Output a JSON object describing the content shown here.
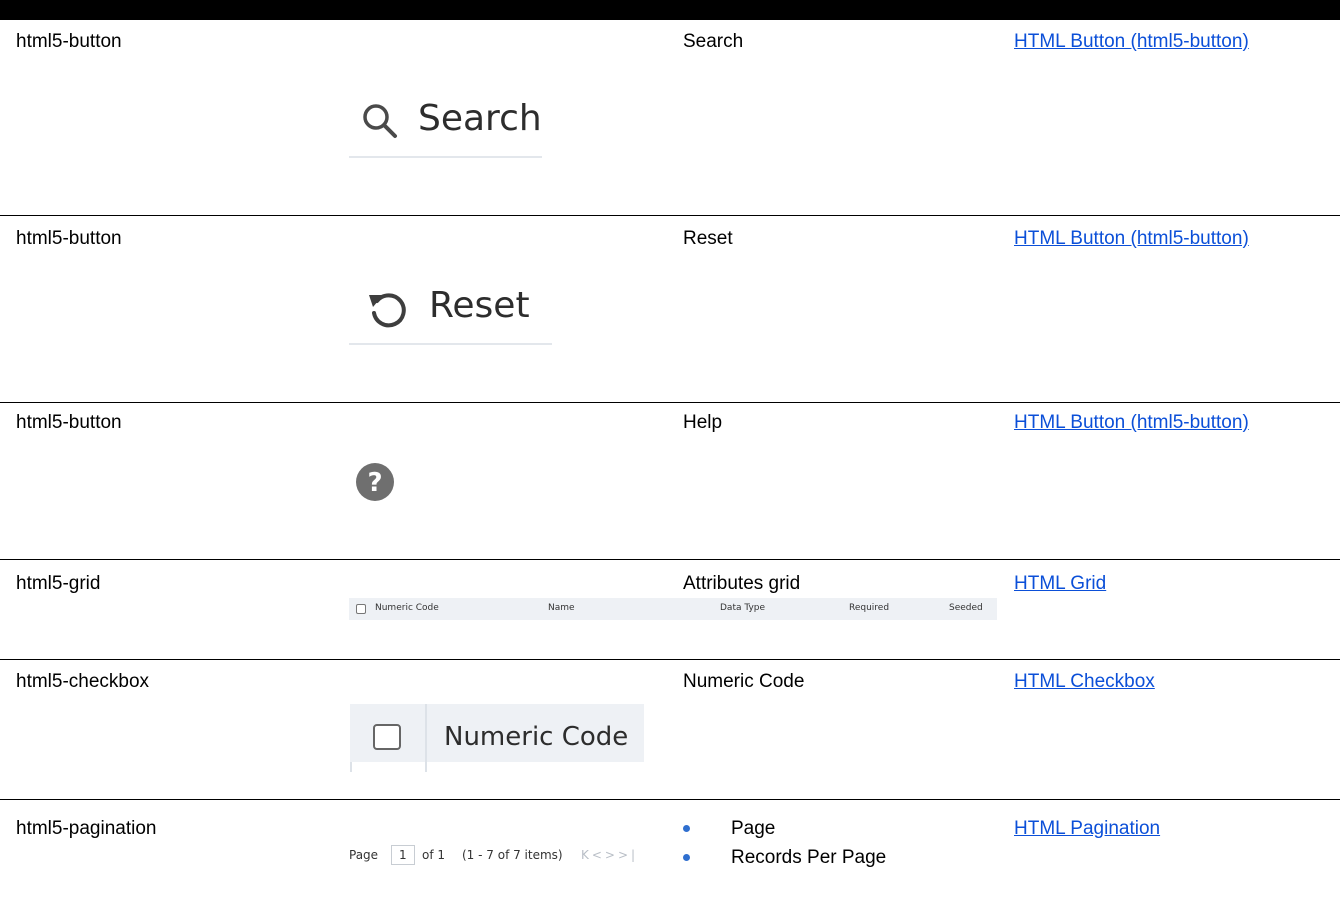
{
  "rows": [
    {
      "component": "html5-button",
      "description": "Search",
      "link": "HTML Button (html5-button)"
    },
    {
      "component": "html5-button",
      "description": "Reset",
      "link": "HTML Button (html5-button)"
    },
    {
      "component": "html5-button",
      "description": "Help",
      "link": "HTML Button (html5-button)"
    },
    {
      "component": "html5-grid",
      "description": "Attributes grid",
      "link": "HTML Grid"
    },
    {
      "component": "html5-checkbox",
      "description": "Numeric Code",
      "link": "HTML Checkbox"
    },
    {
      "component": "html5-pagination",
      "bullets": [
        "Page",
        "Records Per Page"
      ],
      "link": "HTML Pagination"
    }
  ],
  "images": {
    "search_label": "Search",
    "reset_label": "Reset",
    "grid_columns": [
      "Numeric Code",
      "Name",
      "Data Type",
      "Required",
      "Seeded"
    ],
    "checkbox_label": "Numeric Code",
    "pagination": {
      "page_label": "Page",
      "page_value": "1",
      "of_label": "of 1",
      "items_label": "(1 - 7 of  7  items)"
    }
  },
  "colors": {
    "link": "#0b4fd8",
    "bullet": "#2f6fcf",
    "grid_header": "#eef1f5"
  }
}
